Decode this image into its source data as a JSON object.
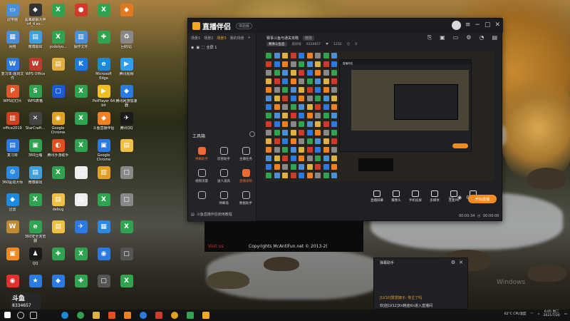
{
  "desktop": {
    "icons": [
      {
        "label": "此电脑",
        "color": "#4a90d9",
        "glyph": "▭"
      },
      {
        "label": "黑鹰破解大神v4_4.ex...",
        "color": "#333",
        "glyph": "◆"
      },
      {
        "label": "",
        "color": "#2fa34f",
        "glyph": "X"
      },
      {
        "label": "",
        "color": "#d03a2a",
        "glyph": "●"
      },
      {
        "label": "",
        "color": "#2fa34f",
        "glyph": "X"
      },
      {
        "label": "",
        "color": "#e07a20",
        "glyph": "◆"
      },
      {
        "label": "网络",
        "color": "#4a90d9",
        "glyph": "▦"
      },
      {
        "label": "微博输出",
        "color": "#3fa0e0",
        "glyph": "▤"
      },
      {
        "label": "yodelyo...",
        "color": "#2fa34f",
        "glyph": "X"
      },
      {
        "label": "操作文件",
        "color": "#4a90d9",
        "glyph": "▥"
      },
      {
        "label": "",
        "color": "#2fa34f",
        "glyph": "✚"
      },
      {
        "label": "回收站",
        "color": "#888",
        "glyph": "♻"
      },
      {
        "label": "复习单-题目文件",
        "color": "#2a7ae2",
        "glyph": "W"
      },
      {
        "label": "WPS Office",
        "color": "#c0392b",
        "glyph": "W"
      },
      {
        "label": "",
        "color": "#e0b040",
        "glyph": "▤"
      },
      {
        "label": "",
        "color": "#1a7ae2",
        "glyph": "K"
      },
      {
        "label": "Microsoft Edge",
        "color": "#1b8ad4",
        "glyph": "e"
      },
      {
        "label": "腾讯视频",
        "color": "#2fa0f0",
        "glyph": "▶"
      },
      {
        "label": "WPS幻灯片",
        "color": "#e0552a",
        "glyph": "P"
      },
      {
        "label": "WPS表格",
        "color": "#2fa34f",
        "glyph": "S"
      },
      {
        "label": "",
        "color": "#1a5ad4",
        "glyph": "▢"
      },
      {
        "label": "",
        "color": "#2fa34f",
        "glyph": "X"
      },
      {
        "label": "PotPlayer 64 bit",
        "color": "#f0c020",
        "glyph": "▶"
      },
      {
        "label": "腾讯网游加速器",
        "color": "#2a7ae2",
        "glyph": "◆"
      },
      {
        "label": "office2019",
        "color": "#d04020",
        "glyph": "▥"
      },
      {
        "label": "StarCraft...",
        "color": "#444",
        "glyph": "✕"
      },
      {
        "label": "Google Chrome",
        "color": "#e0a020",
        "glyph": "◉"
      },
      {
        "label": "",
        "color": "#2fa34f",
        "glyph": "X"
      },
      {
        "label": "斗鱼直播伴侣",
        "color": "#f08020",
        "glyph": "◆"
      },
      {
        "label": "腾讯QQ",
        "color": "#1a1a1a",
        "glyph": "✈"
      },
      {
        "label": "复习单",
        "color": "#2a7ae2",
        "glyph": "▤"
      },
      {
        "label": "360压缩",
        "color": "#2fa34f",
        "glyph": "▣"
      },
      {
        "label": "腾讯手游助手",
        "color": "#e05020",
        "glyph": "◐"
      },
      {
        "label": "",
        "color": "#2fa34f",
        "glyph": "X"
      },
      {
        "label": "Google Chrome",
        "color": "#2a7ae2",
        "glyph": "▣"
      },
      {
        "label": "",
        "color": "#f0c040",
        "glyph": "▤"
      },
      {
        "label": "360驱动大师",
        "color": "#2a8ae2",
        "glyph": "⚙"
      },
      {
        "label": "微博输出",
        "color": "#3fa0e0",
        "glyph": "▤"
      },
      {
        "label": "",
        "color": "#2fa34f",
        "glyph": "X"
      },
      {
        "label": "",
        "color": "#eee",
        "glyph": "▢"
      },
      {
        "label": "",
        "color": "#e0a020",
        "glyph": "▥"
      },
      {
        "label": "",
        "color": "#888",
        "glyph": "▢"
      },
      {
        "label": "迅雷",
        "color": "#1a8ae2",
        "glyph": "◆"
      },
      {
        "label": "",
        "color": "#2fa34f",
        "glyph": "X"
      },
      {
        "label": "debug",
        "color": "#f0c040",
        "glyph": "▤"
      },
      {
        "label": "",
        "color": "#eee",
        "glyph": "▤"
      },
      {
        "label": "",
        "color": "#2fa34f",
        "glyph": "X"
      },
      {
        "label": "",
        "color": "#888",
        "glyph": "▢"
      },
      {
        "label": "",
        "color": "#c08a30",
        "glyph": "W"
      },
      {
        "label": "360安全浏览器",
        "color": "#2fa34f",
        "glyph": "e"
      },
      {
        "label": "",
        "color": "#f0c040",
        "glyph": "▤"
      },
      {
        "label": "",
        "color": "#2a7ae2",
        "glyph": "✈"
      },
      {
        "label": "",
        "color": "#2a8ae2",
        "glyph": "▦"
      },
      {
        "label": "",
        "color": "#2fa34f",
        "glyph": "X"
      },
      {
        "label": "",
        "color": "#f08a20",
        "glyph": "▣"
      },
      {
        "label": "QQ",
        "color": "#1a1a1a",
        "glyph": "♟"
      },
      {
        "label": "",
        "color": "#2fa34f",
        "glyph": "✚"
      },
      {
        "label": "",
        "color": "#2fa34f",
        "glyph": "X"
      },
      {
        "label": "",
        "color": "#2a7ae2",
        "glyph": "◉"
      },
      {
        "label": "",
        "color": "#555",
        "glyph": "▢"
      },
      {
        "label": "",
        "color": "#e03030",
        "glyph": "◉"
      },
      {
        "label": "",
        "color": "#2a7ae2",
        "glyph": "★"
      },
      {
        "label": "",
        "color": "#2a7ae2",
        "glyph": "◆"
      },
      {
        "label": "",
        "color": "#2fa34f",
        "glyph": "✚"
      },
      {
        "label": "",
        "color": "#555",
        "glyph": "▢"
      },
      {
        "label": "",
        "color": "#2fa34f",
        "glyph": "X"
      }
    ]
  },
  "app": {
    "logo_text": "直播伴侣",
    "version_badge": "体验版",
    "sidebar_tabs": [
      {
        "label": "场景1",
        "active": false
      },
      {
        "label": "场景2",
        "active": false
      },
      {
        "label": "场景3",
        "active": true
      },
      {
        "label": "我的场景",
        "active": false
      }
    ],
    "scene_label": "全屏 1",
    "tools_title": "工具箱",
    "tools": [
      {
        "label": "弹幕助手",
        "hl": true
      },
      {
        "label": "房管助手",
        "hl": false
      },
      {
        "label": "主播任务",
        "hl": false
      },
      {
        "label": "视频流量",
        "hl": false
      },
      {
        "label": "送人道具",
        "hl": false
      },
      {
        "label": "直播录制",
        "hl": true
      },
      {
        "label": "",
        "hl": false
      },
      {
        "label": "弹幕墙",
        "hl": false
      },
      {
        "label": "数据助手",
        "hl": false
      }
    ],
    "help_text": "斗鱼直播伴侣使用教程",
    "main_title": "赛事斗鱼与通关攻略",
    "main_title_badge": "修改",
    "main_sub": {
      "category": "赛事斗鱼直",
      "room_label": "房间号",
      "room_id": "8334657",
      "fans": "1232",
      "count": "0"
    },
    "bottom_buttons": [
      "直播屏幕",
      "摄像头",
      "手机投屏",
      "多媒体",
      "连麦PK",
      "音乐声"
    ],
    "go_live_label": "开始直播",
    "status": {
      "bitrate": "00:00:34",
      "time": "00:00:00"
    }
  },
  "overlay": {
    "copyright_red": "Visit us",
    "copyright_text": "Copyrights McAntiFun.net © 2013-2("
  },
  "chat": {
    "title": "弹幕助手",
    "line1": "[LV10]慧慧嫂子: 你主了吗",
    "line2": "欢迎[LV12]Xn韩迪Kn进入直播间"
  },
  "badge": {
    "logo": "斗鱼",
    "room": "8334657"
  },
  "watermark": "Windows",
  "tray": {
    "weather": "62°C CPU温度",
    "time": "6:05 周二",
    "date": "2021/7/20"
  }
}
